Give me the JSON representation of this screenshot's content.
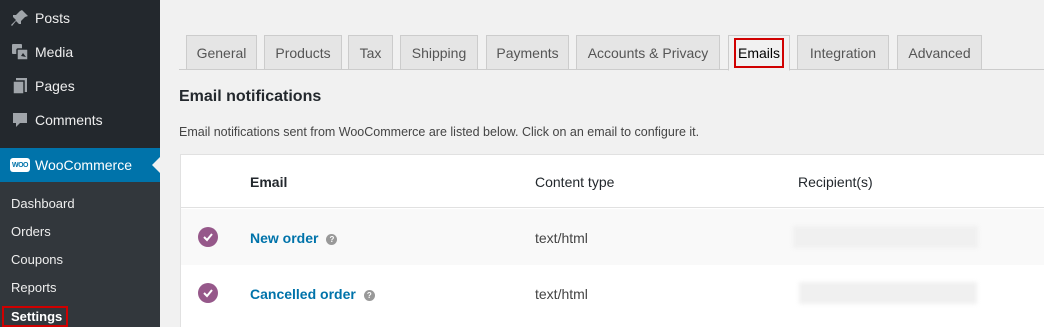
{
  "sidebar": {
    "items": [
      {
        "label": "Posts",
        "icon": "pin-icon"
      },
      {
        "label": "Media",
        "icon": "media-icon"
      },
      {
        "label": "Pages",
        "icon": "pages-icon"
      },
      {
        "label": "Comments",
        "icon": "comments-icon"
      },
      {
        "label": "WooCommerce",
        "icon": "woo-icon",
        "badge": "WOO"
      }
    ],
    "submenu": [
      "Dashboard",
      "Orders",
      "Coupons",
      "Reports",
      "Settings"
    ]
  },
  "tabs": [
    "General",
    "Products",
    "Tax",
    "Shipping",
    "Payments",
    "Accounts & Privacy",
    "Emails",
    "Integration",
    "Advanced"
  ],
  "active_tab": "Emails",
  "section": {
    "title": "Email notifications",
    "description": "Email notifications sent from WooCommerce are listed below. Click on an email to configure it."
  },
  "table": {
    "headers": {
      "email": "Email",
      "content_type": "Content type",
      "recipients": "Recipient(s)"
    },
    "rows": [
      {
        "email": "New order",
        "help": "?",
        "content_type": "text/html"
      },
      {
        "email": "Cancelled order",
        "help": "?",
        "content_type": "text/html"
      }
    ]
  },
  "colors": {
    "sidebar": "#23282d",
    "accent": "#0073aa",
    "check": "#96588a",
    "highlight": "#d00000"
  }
}
